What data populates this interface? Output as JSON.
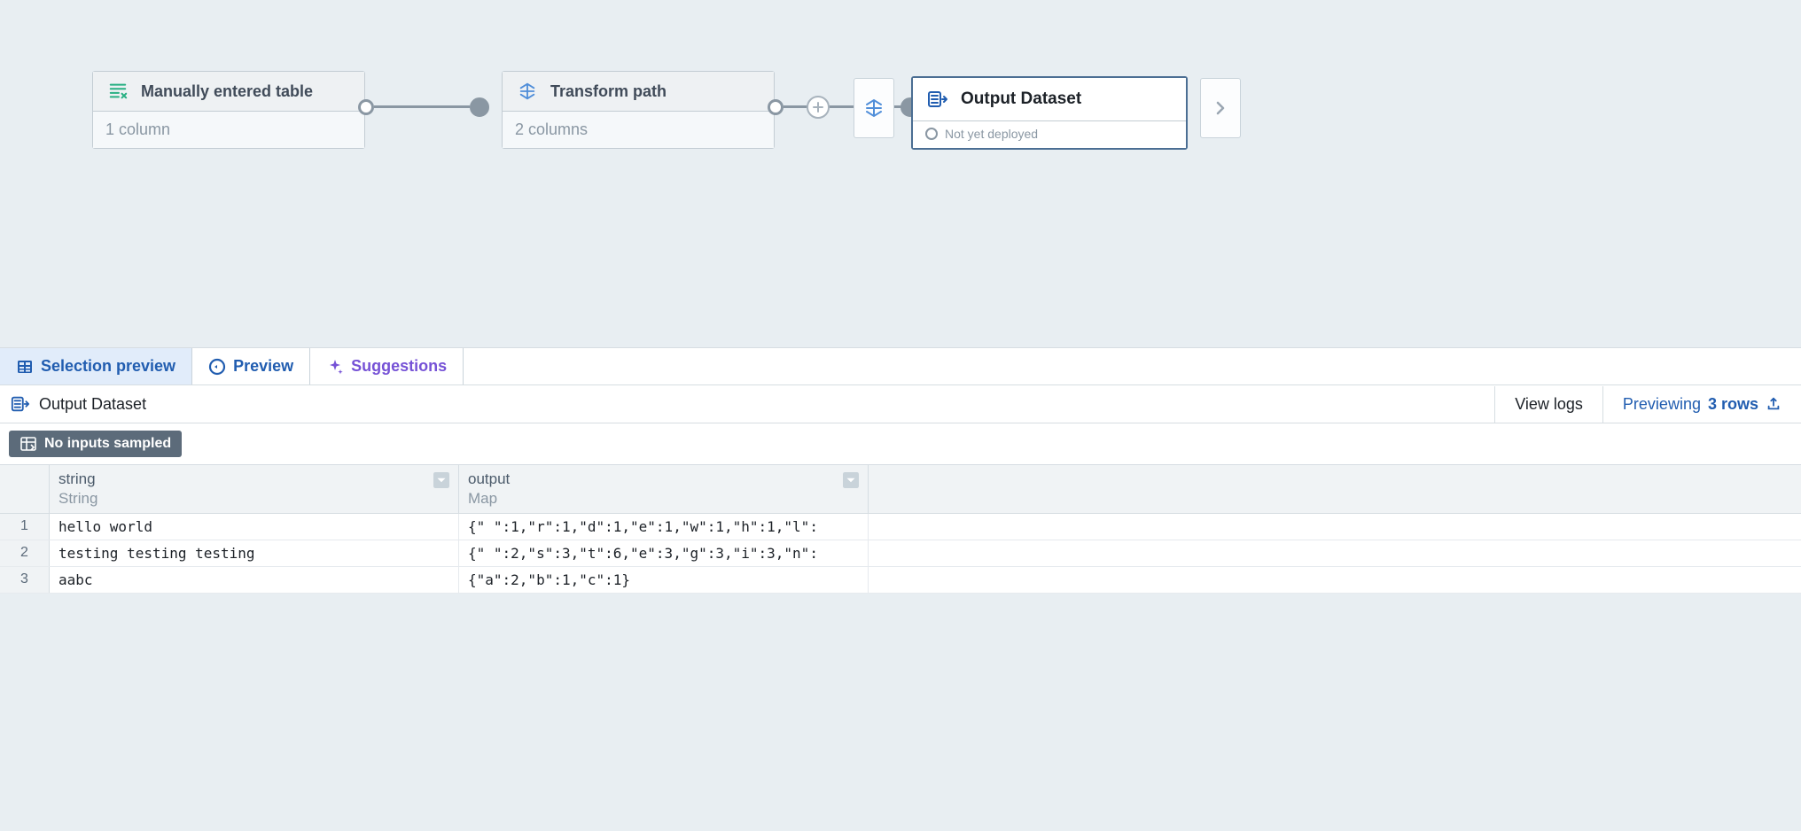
{
  "canvas": {
    "nodes": {
      "manual": {
        "title": "Manually entered table",
        "subtitle": "1 column"
      },
      "transform": {
        "title": "Transform path",
        "subtitle": "2 columns"
      },
      "output": {
        "title": "Output Dataset",
        "status": "Not yet deployed"
      }
    },
    "smallbox_icon": "transform-icon",
    "chevron_box": "›"
  },
  "tabs": {
    "selection_preview": "Selection preview",
    "preview": "Preview",
    "suggestions": "Suggestions"
  },
  "panel": {
    "title": "Output Dataset",
    "view_logs": "View logs",
    "previewing_label": "Previewing",
    "previewing_count": "3 rows"
  },
  "inputs_badge": "No inputs sampled",
  "table": {
    "columns": [
      {
        "name": "string",
        "type": "String"
      },
      {
        "name": "output",
        "type": "Map"
      }
    ],
    "rows": [
      {
        "num": "1",
        "cells": [
          "hello world",
          "{\" \":1,\"r\":1,\"d\":1,\"e\":1,\"w\":1,\"h\":1,\"l\":"
        ]
      },
      {
        "num": "2",
        "cells": [
          "testing testing testing",
          "{\" \":2,\"s\":3,\"t\":6,\"e\":3,\"g\":3,\"i\":3,\"n\":"
        ]
      },
      {
        "num": "3",
        "cells": [
          "aabc",
          "{\"a\":2,\"b\":1,\"c\":1}"
        ]
      }
    ]
  }
}
